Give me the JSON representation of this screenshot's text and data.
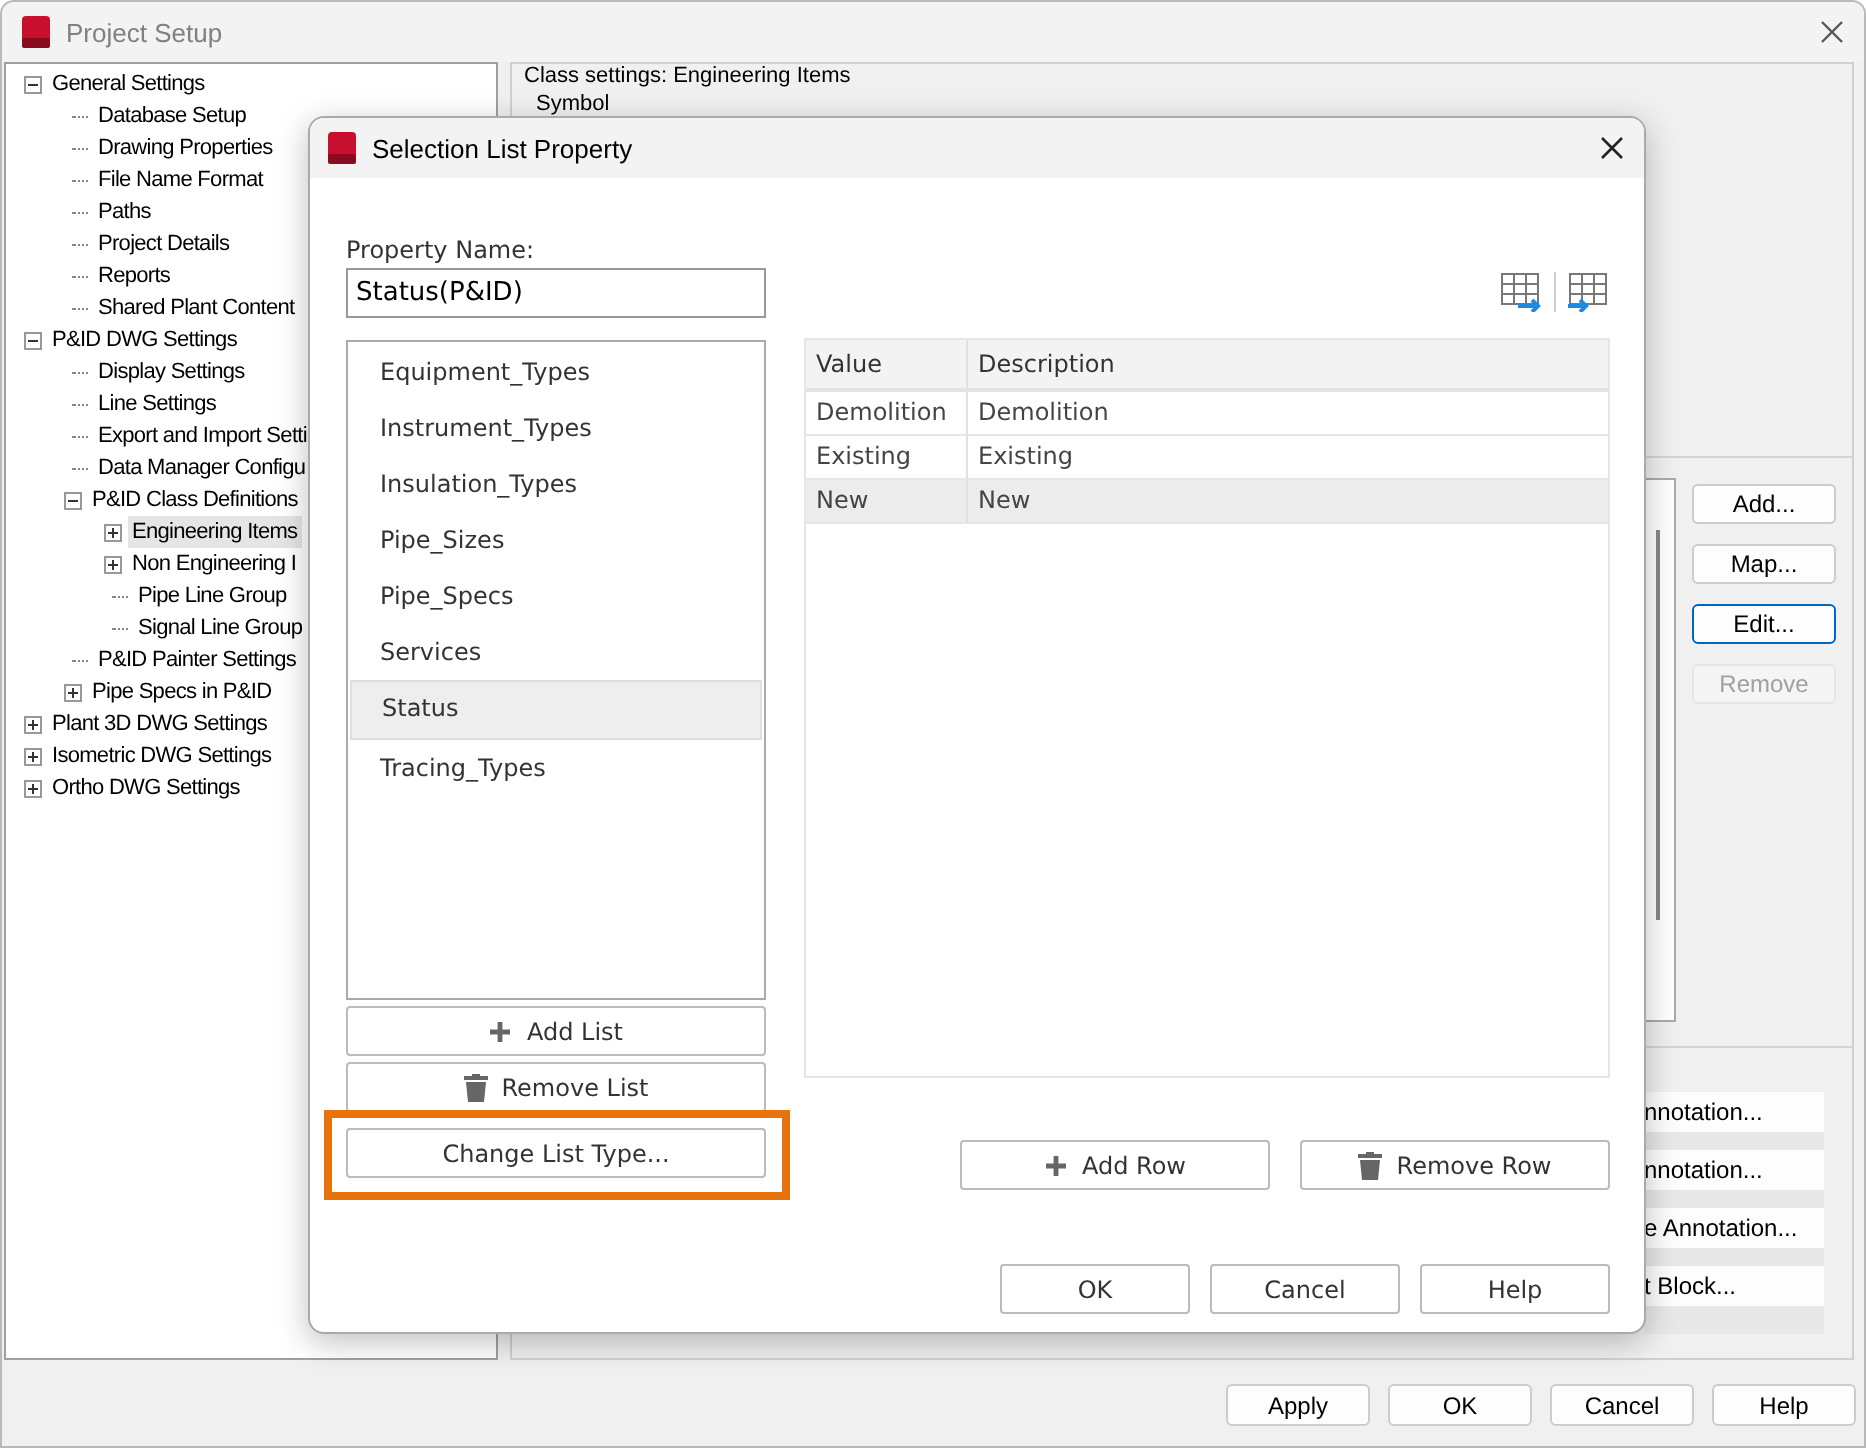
{
  "window": {
    "title": "Project Setup"
  },
  "tree": [
    {
      "label": "General Settings",
      "expanded": true,
      "selected": false,
      "children": [
        {
          "label": "Database Setup",
          "selected": false
        },
        {
          "label": "Drawing Properties",
          "selected": false
        },
        {
          "label": "File Name Format",
          "selected": false
        },
        {
          "label": "Paths",
          "selected": false
        },
        {
          "label": "Project Details",
          "selected": false
        },
        {
          "label": "Reports",
          "selected": false
        },
        {
          "label": "Shared Plant Content",
          "selected": false
        }
      ]
    },
    {
      "label": "P&ID DWG Settings",
      "expanded": true,
      "selected": false,
      "children": [
        {
          "label": "Display Settings",
          "selected": false
        },
        {
          "label": "Line Settings",
          "selected": false
        },
        {
          "label": "Export and Import Setti",
          "selected": false
        },
        {
          "label": "Data Manager Configu",
          "selected": false
        },
        {
          "label": "P&ID Class Definitions",
          "expanded": true,
          "selected": false,
          "children": [
            {
              "label": "Engineering Items",
              "expanded": false,
              "selected": true
            },
            {
              "label": "Non Engineering I",
              "expanded": false,
              "selected": false
            },
            {
              "label": "Pipe Line Group",
              "selected": false
            },
            {
              "label": "Signal Line Group",
              "selected": false
            }
          ]
        },
        {
          "label": "P&ID Painter Settings",
          "selected": false
        },
        {
          "label": "Pipe Specs in P&ID",
          "expanded": false,
          "selected": false
        }
      ]
    },
    {
      "label": "Plant 3D DWG Settings",
      "expanded": false,
      "selected": false
    },
    {
      "label": "Isometric DWG Settings",
      "expanded": false,
      "selected": false
    },
    {
      "label": "Ortho DWG Settings",
      "expanded": false,
      "selected": false
    }
  ],
  "class_settings": {
    "title": "Class settings: Engineering Items",
    "symbol_label": "Symbol"
  },
  "side_buttons": [
    {
      "label": "Add...",
      "focused": false,
      "disabled": false
    },
    {
      "label": "Map...",
      "focused": false,
      "disabled": false
    },
    {
      "label": "Edit...",
      "focused": true,
      "disabled": false
    },
    {
      "label": "Remove",
      "focused": false,
      "disabled": true
    }
  ],
  "annotation_buttons": [
    "nnotation...",
    "nnotation...",
    "e Annotation...",
    "t Block..."
  ],
  "footer_buttons": [
    "Apply",
    "OK",
    "Cancel",
    "Help"
  ],
  "dialog": {
    "title": "Selection List Property",
    "property_name_label": "Property Name:",
    "property_name": "Status(P&ID)",
    "lists": [
      {
        "label": "Equipment_Types",
        "selected": false
      },
      {
        "label": "Instrument_Types",
        "selected": false
      },
      {
        "label": "Insulation_Types",
        "selected": false
      },
      {
        "label": "Pipe_Sizes",
        "selected": false
      },
      {
        "label": "Pipe_Specs",
        "selected": false
      },
      {
        "label": "Services",
        "selected": false
      },
      {
        "label": "Status",
        "selected": true
      },
      {
        "label": "Tracing_Types",
        "selected": false
      }
    ],
    "list_buttons": [
      {
        "label": "Add List",
        "kind": "add",
        "highlighted": false
      },
      {
        "label": "Remove List",
        "kind": "remove",
        "highlighted": false
      },
      {
        "label": "Change List Type...",
        "kind": "plain",
        "highlighted": true
      }
    ],
    "table": {
      "columns": [
        "Value",
        "Description"
      ],
      "rows": [
        {
          "cells": [
            "Demolition",
            "Demolition"
          ],
          "selected": false
        },
        {
          "cells": [
            "Existing",
            "Existing"
          ],
          "selected": false
        },
        {
          "cells": [
            "New",
            "New"
          ],
          "selected": true
        }
      ]
    },
    "row_buttons": [
      {
        "label": "Add Row",
        "kind": "add"
      },
      {
        "label": "Remove Row",
        "kind": "remove"
      }
    ],
    "buttons": [
      "OK",
      "Cancel",
      "Help"
    ]
  }
}
